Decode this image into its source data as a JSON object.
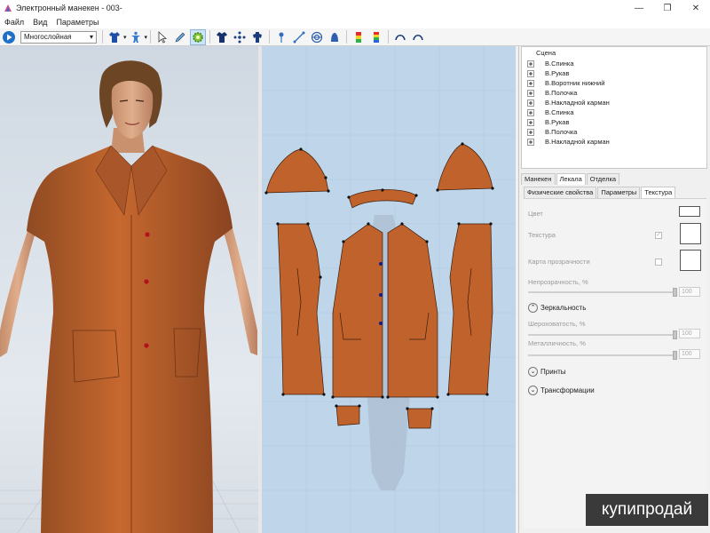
{
  "window": {
    "title": "Электронный манекен - 003-"
  },
  "menu": [
    "Файл",
    "Вид",
    "Параметры"
  ],
  "toolbar": {
    "layer_mode": "Многослойная",
    "icons": [
      "play-icon",
      "shirt-icon",
      "dropdown-arrow-icon",
      "mannequin-icon",
      "dropdown-arrow-icon",
      "select-arrow-icon",
      "pen-tool-icon",
      "settings-gear-icon",
      "garment-icon",
      "move-points-icon",
      "mannequin-front-icon",
      "pin-icon",
      "line-measure-icon",
      "target-icon",
      "bell-shape-icon",
      "color-gradient-icon",
      "rainbow-gradient-icon",
      "curve-left-icon",
      "curve-right-icon"
    ]
  },
  "scene_tree": {
    "root": "Сцена",
    "items": [
      "В.Спинка",
      "В.Рукав",
      "В.Воротник нижний",
      "В.Полочка",
      "В.Накладной карман",
      "В.Спинка",
      "В.Рукав",
      "В.Полочка",
      "В.Накладной карман"
    ]
  },
  "tabs_primary": [
    "Манекен",
    "Лекала",
    "Отделка"
  ],
  "tabs_primary_selected": "Лекала",
  "tabs_secondary": [
    "Физические свойства",
    "Параметры",
    "Текстура"
  ],
  "tabs_secondary_selected": "Текстура",
  "properties": {
    "color_label": "Цвет",
    "texture_label": "Текстура",
    "texture_checked": "✓",
    "transparency_map_label": "Карта прозрачности",
    "opacity_label": "Непрозрачность, %",
    "opacity_value": "100",
    "mirror_section": "Зеркальность",
    "roughness_label": "Шероховатость, %",
    "roughness_value": "100",
    "metallic_label": "Металличность, %",
    "metallic_value": "100",
    "prints_section": "Принты",
    "transforms_section": "Трансформации"
  },
  "colors": {
    "fabric": "#c0622b",
    "fabric_dark": "#8a4520",
    "pattern_bg": "#bfd6ea",
    "button": "#b3121c"
  },
  "watermark": "купипродай"
}
